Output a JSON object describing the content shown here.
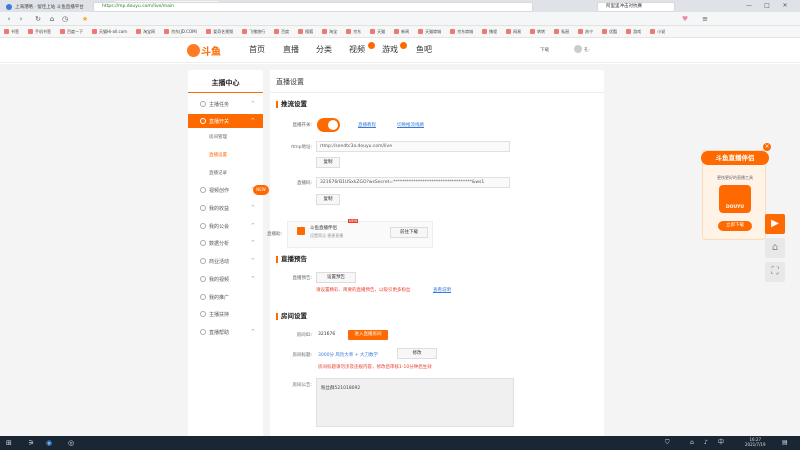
{
  "browser": {
    "tabs": [
      {
        "label": "上海港略 · 留佳上站 斗鱼直播平台",
        "icon": "tab-favicon-icon"
      },
      {
        "label": "直播中心",
        "icon": "douyu-favicon-icon"
      }
    ],
    "new_tab": "+",
    "url": "https://mp.douyu.com/live/main",
    "search_placeholder": "阿里里冲击对抗赛",
    "window_controls": [
      "□",
      "—",
      "□",
      "✕"
    ],
    "bookmarks": [
      "书签",
      "手机书签",
      "百度一下",
      "天猫Hi-all.com",
      "淘宝网",
      "京东(JD.COM)",
      "爱奇艺视频",
      "飞猪旅行",
      "百度",
      "搜狐",
      "淘宝",
      "京东",
      "天猫",
      "新闻",
      "天猫商城",
      "京东商城",
      "携程",
      "网易",
      "转转",
      "私厨",
      "苏宁",
      "优酷",
      "游戏",
      "小说"
    ]
  },
  "site": {
    "logo": "斗鱼",
    "nav": [
      "首页",
      "直播",
      "分类",
      "视频",
      "游戏",
      "鱼吧"
    ],
    "user_hint": "下载",
    "user_name": "孔·"
  },
  "sidebar": {
    "title": "主播中心",
    "items": [
      {
        "label": "主播任务",
        "chev": "^"
      },
      {
        "label": "直播开关",
        "chev": "^"
      },
      {
        "label": "视频创作",
        "chev": "^"
      },
      {
        "label": "我的收益",
        "chev": "^"
      },
      {
        "label": "我的公会",
        "chev": "^"
      },
      {
        "label": "数据分析",
        "chev": "^"
      },
      {
        "label": "商业活动",
        "chev": "^"
      },
      {
        "label": "我的视频",
        "chev": "^"
      },
      {
        "label": "我的推广",
        "chev": ""
      },
      {
        "label": "主播扶持",
        "chev": ""
      },
      {
        "label": "直播帮助",
        "chev": "^"
      }
    ],
    "subitems": [
      "房间管理",
      "直播设置",
      "直播记录"
    ],
    "new_badge": "NEW"
  },
  "main": {
    "title": "直播设置",
    "push": {
      "heading": "推流设置",
      "switch_label": "直播开关:",
      "link1": "直播教程",
      "link2": "切换推流线路",
      "rtmp_label": "rtmp地址:",
      "rtmp_value": "rtmp://sendtc3a.douyu.com/live",
      "copy": "复制",
      "code_label": "直播码:",
      "code_value": "321676rB1USxkZGO?wsSecret=***********************************&ws1",
      "copy2": "复制",
      "promo_label": "直播助:",
      "promo_title": "斗鱼直播伴侣",
      "promo_sub": "设置简洁 便捷直播",
      "promo_new": "NEW",
      "promo_btn": "前往下载"
    },
    "preview": {
      "heading": "直播预告",
      "label": "直播预告:",
      "btn": "设置预告",
      "warn": "请设置精彩、简要的直播预告，以吸引更多粉丝",
      "link": "查看说明"
    },
    "room": {
      "heading": "房间设置",
      "id_label": "房间ID:",
      "id_value": "321676",
      "enter_btn": "进入直播房间",
      "title_label": "房间标题:",
      "title_value": "3000分 风险大师 + 大刀数学",
      "modify_btn": "修改",
      "title_warn": "房间标题请勿涉及违规内容，修改后审核1-10分钟后生效",
      "ann_label": "房间公告:",
      "ann_value": "粉丝群521018092"
    }
  },
  "float_ad": {
    "title": "斗鱼直播伴侣",
    "sub": "更快更好的直播工具",
    "app": "DOUYU",
    "btn": "立即下载",
    "close": "×"
  },
  "taskbar": {
    "time": "16:27",
    "date": "2021/7/19"
  },
  "colors": {
    "accent": "#ff6a00",
    "link": "#3b7ad9",
    "warn": "#e83c2c"
  }
}
